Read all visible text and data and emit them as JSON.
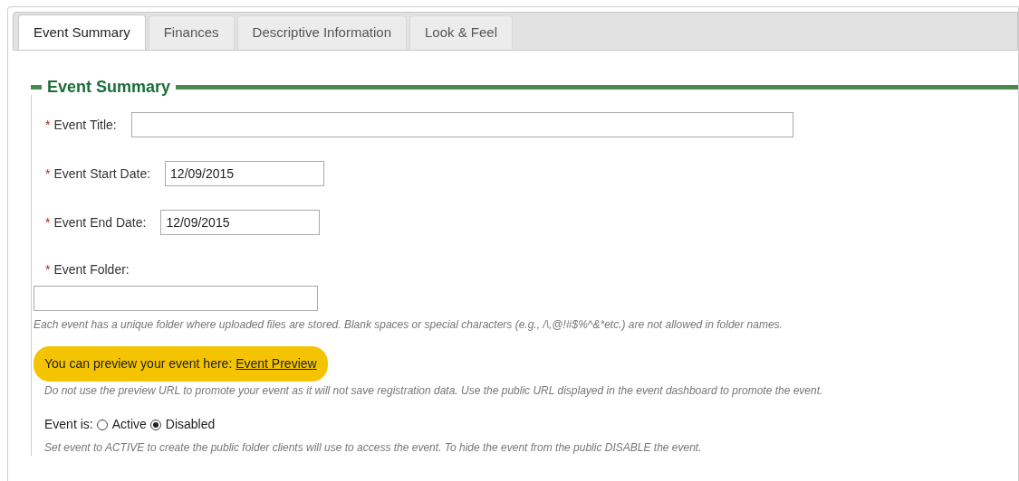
{
  "tabs": [
    {
      "label": "Event Summary",
      "selected": true
    },
    {
      "label": "Finances",
      "selected": false
    },
    {
      "label": "Descriptive Information",
      "selected": false
    },
    {
      "label": "Look & Feel",
      "selected": false
    }
  ],
  "section": {
    "title": "Event Summary"
  },
  "fields": [
    {
      "label": "Event Title:",
      "required_mark": "*"
    },
    {
      "label": "Event Start Date:",
      "required_mark": "*",
      "value": "12/09/2015"
    },
    {
      "label": "Event End Date:",
      "required_mark": "*",
      "value": "12/09/2015"
    },
    {
      "label": "Event Folder:",
      "required_mark": "*",
      "help": "Each event has a unique folder where uploaded files are stored.  Blank spaces or special characters (e.g., /\\,@!#$%^&*etc.) are not allowed in folder names."
    }
  ],
  "preview": {
    "text": "You can preview your event here:",
    "link": "Event Preview",
    "highlighted": true,
    "help": "Do not use the preview URL to promote your event as it will not save registration data. Use the public URL displayed in the event dashboard to promote the event."
  },
  "status": {
    "label": "Event is:",
    "options": [
      {
        "label": "Active",
        "selected": false
      },
      {
        "label": "Disabled",
        "selected": true
      }
    ],
    "help": "Set event to ACTIVE to create the public folder clients will use to access the event. To hide the event from the public DISABLE the event."
  }
}
